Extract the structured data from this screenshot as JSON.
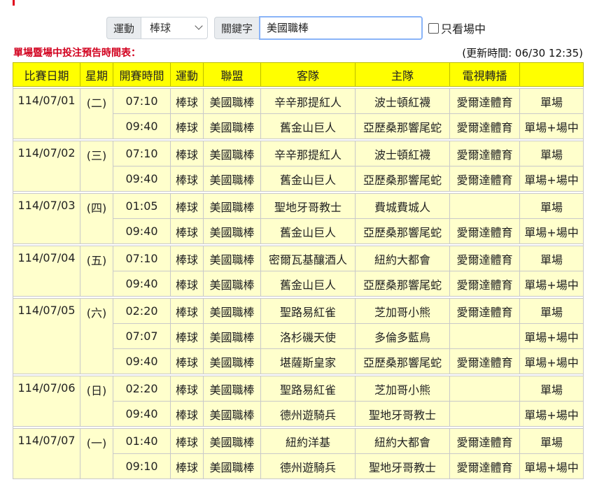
{
  "filters": {
    "sport_label": "運動",
    "sport_value": "棒球",
    "keyword_label": "關鍵字",
    "keyword_value": "美國職棒",
    "only_watch_label": "只看場中"
  },
  "schedule_title": "單場暨場中投注預告時間表：",
  "updated_text": "(更新時間: 06/30 12:35)",
  "headers": [
    "比賽日期",
    "星期",
    "開賽時間",
    "運動",
    "聯盟",
    "客隊",
    "主隊",
    "電視轉播",
    ""
  ],
  "days": [
    {
      "date": "114/07/01",
      "weekday": "(二)",
      "games": [
        {
          "time": "07:10",
          "sport": "棒球",
          "league": "美國職棒",
          "away": "辛辛那提紅人",
          "home": "波士頓紅襪",
          "tv": "愛爾達體育",
          "type": "單場"
        },
        {
          "time": "09:40",
          "sport": "棒球",
          "league": "美國職棒",
          "away": "舊金山巨人",
          "home": "亞歷桑那響尾蛇",
          "tv": "愛爾達體育",
          "type": "單場+場中"
        }
      ]
    },
    {
      "date": "114/07/02",
      "weekday": "(三)",
      "games": [
        {
          "time": "07:10",
          "sport": "棒球",
          "league": "美國職棒",
          "away": "辛辛那提紅人",
          "home": "波士頓紅襪",
          "tv": "愛爾達體育",
          "type": "單場"
        },
        {
          "time": "09:40",
          "sport": "棒球",
          "league": "美國職棒",
          "away": "舊金山巨人",
          "home": "亞歷桑那響尾蛇",
          "tv": "愛爾達體育",
          "type": "單場+場中"
        }
      ]
    },
    {
      "date": "114/07/03",
      "weekday": "(四)",
      "games": [
        {
          "time": "01:05",
          "sport": "棒球",
          "league": "美國職棒",
          "away": "聖地牙哥教士",
          "home": "費城費城人",
          "tv": "",
          "type": "單場"
        },
        {
          "time": "09:40",
          "sport": "棒球",
          "league": "美國職棒",
          "away": "舊金山巨人",
          "home": "亞歷桑那響尾蛇",
          "tv": "愛爾達體育",
          "type": "單場+場中"
        }
      ]
    },
    {
      "date": "114/07/04",
      "weekday": "(五)",
      "games": [
        {
          "time": "07:10",
          "sport": "棒球",
          "league": "美國職棒",
          "away": "密爾瓦基釀酒人",
          "home": "紐約大都會",
          "tv": "愛爾達體育",
          "type": "單場"
        },
        {
          "time": "09:40",
          "sport": "棒球",
          "league": "美國職棒",
          "away": "舊金山巨人",
          "home": "亞歷桑那響尾蛇",
          "tv": "愛爾達體育",
          "type": "單場+場中"
        }
      ]
    },
    {
      "date": "114/07/05",
      "weekday": "(六)",
      "games": [
        {
          "time": "02:20",
          "sport": "棒球",
          "league": "美國職棒",
          "away": "聖路易紅雀",
          "home": "芝加哥小熊",
          "tv": "愛爾達體育",
          "type": "單場"
        },
        {
          "time": "07:07",
          "sport": "棒球",
          "league": "美國職棒",
          "away": "洛杉磯天使",
          "home": "多倫多藍鳥",
          "tv": "",
          "type": "單場+場中"
        },
        {
          "time": "09:40",
          "sport": "棒球",
          "league": "美國職棒",
          "away": "堪薩斯皇家",
          "home": "亞歷桑那響尾蛇",
          "tv": "愛爾達體育",
          "type": "單場+場中"
        }
      ]
    },
    {
      "date": "114/07/06",
      "weekday": "(日)",
      "games": [
        {
          "time": "02:20",
          "sport": "棒球",
          "league": "美國職棒",
          "away": "聖路易紅雀",
          "home": "芝加哥小熊",
          "tv": "",
          "type": "單場"
        },
        {
          "time": "09:40",
          "sport": "棒球",
          "league": "美國職棒",
          "away": "德州遊騎兵",
          "home": "聖地牙哥教士",
          "tv": "",
          "type": "單場+場中"
        }
      ]
    },
    {
      "date": "114/07/07",
      "weekday": "(一)",
      "games": [
        {
          "time": "01:40",
          "sport": "棒球",
          "league": "美國職棒",
          "away": "紐約洋基",
          "home": "紐約大都會",
          "tv": "愛爾達體育",
          "type": "單場"
        },
        {
          "time": "09:10",
          "sport": "棒球",
          "league": "美國職棒",
          "away": "德州遊騎兵",
          "home": "聖地牙哥教士",
          "tv": "愛爾達體育",
          "type": "單場+場中"
        }
      ]
    }
  ]
}
